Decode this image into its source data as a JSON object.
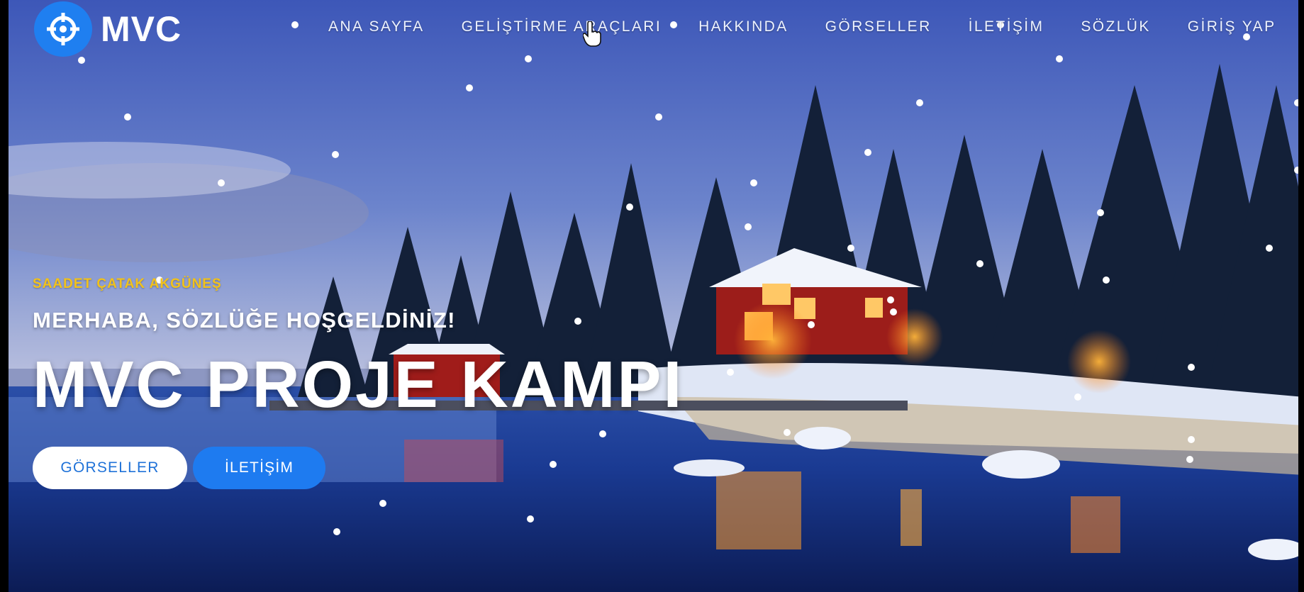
{
  "brand": {
    "name": "MVC",
    "logo_icon": "crosshair-icon",
    "logo_color": "#1f7ff0"
  },
  "nav": {
    "items": [
      {
        "label": "ANA SAYFA"
      },
      {
        "label": "GELİŞTİRME ARAÇLARI"
      },
      {
        "label": "HAKKINDA"
      },
      {
        "label": "GÖRSELLER"
      },
      {
        "label": "İLETİŞİM"
      },
      {
        "label": "SÖZLÜK"
      },
      {
        "label": "GİRİŞ YAP"
      }
    ]
  },
  "hero": {
    "author": "SAADET ÇATAK AKGÜNEŞ",
    "subtitle": "MERHABA, SÖZLÜĞE HOŞGELDİNİZ!",
    "title": "MVC PROJE KAMPI",
    "buttons": {
      "primary_label": "GÖRSELLER",
      "secondary_label": "İLETİŞİM"
    }
  },
  "background": {
    "description_icon": "winter-lake-scene",
    "snow_icon": "snowflake-dots"
  },
  "colors": {
    "accent": "#1e7bf0",
    "author": "#f2c21a",
    "button_text": "#1f72d8"
  },
  "cursor_icon": "hand-pointer-icon"
}
